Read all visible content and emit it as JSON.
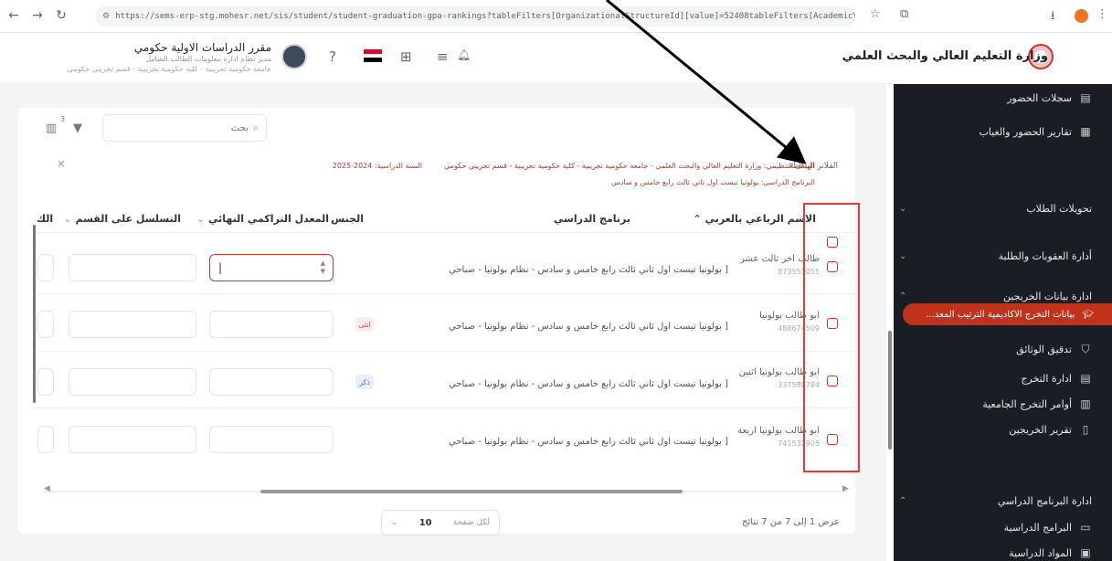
{
  "browser": {
    "url": "https://sems-erp-stg.mohesr.net/sis/student/student-graduation-gpa-rankings?tableFilters[OrganizationalStructureId][value]=52408tableFilters[AcademicYearAndProgram][StudyYearId]=1258tu..."
  },
  "header": {
    "ministry_name": "وزارة التعليم العالي والبحث العلمي",
    "user_name": "مقرر الدراسات الاولية حكومي",
    "user_role": "مدير نظام ادارة معلومات الطالب الشامل",
    "user_unit": "جامعة حكومية تجريبية - كلية حكومية تجريبية - قسم تجريبي حكومي"
  },
  "sidebar": {
    "item_attendance_records": "سجلات الحضور",
    "item_attendance_reports": "تقارير الحضور والغياب",
    "group_student_transfers": "تحويلات الطلاب",
    "group_penalties": "أدارة العقوبات والطلبة",
    "group_graduates_data": "ادارة بيانات الخريجين",
    "active_item": "بيانات التخرج الاكاديمية الترتيب المعد...",
    "item_document_check": "تدقيق الوثائق",
    "item_graduation_mgmt": "ادارة التخرج",
    "item_university_orders": "أوامر التخرج الجامعية",
    "item_graduates_report": "تقرير الخريجين",
    "group_program_mgmt": "ادارة البرنامج الدراسي",
    "item_programs": "البرامج الدراسية",
    "item_last": "المواد الدراسية"
  },
  "toolbar": {
    "search_placeholder": "بحث",
    "filter_count": "3"
  },
  "filters": {
    "label": "الفلاتر النشطة",
    "chip_org": "الهيكل التنظيمي: وزارة التعليم العالي والبحث العلمي - جامعة حكومية تجريبية - كلية حكومية تجريبية - قسم تجريبي حكومي",
    "chip_year": "السنة الدراسية: 2024-2025",
    "chip_program": "البرنامج الدراسي: بولونيا تيست اول ثاني ثالث رابع خامس و سادس"
  },
  "table": {
    "columns": {
      "name": "الاسم الرباعي بالعربي",
      "program": "برنامج الدراسي",
      "gender": "الجنس",
      "gpa": "المعدل التراكمي النهائي",
      "dept_rank": "التسلسل على القسم",
      "last": "الك"
    },
    "rows": [
      {
        "name": "طالب اخر ثالث عشر",
        "id": "873551055",
        "program": "[ بولونيا تيست اول ثاني ثالث رابع خامس و سادس - نظام بولونيا - صباحي",
        "gender": ""
      },
      {
        "name": "ابو طالب بولونيا",
        "id": "488674509",
        "program": "[ بولونيا تيست اول ثاني ثالث رابع خامس و سادس - نظام بولونيا - صباحي",
        "gender": "انثى"
      },
      {
        "name": "ابو طالب بولونيا اثنين",
        "id": "337580784",
        "program": "[ بولونيا تيست اول ثاني ثالث رابع خامس و سادس - نظام بولونيا - صباحي",
        "gender": "ذكر"
      },
      {
        "name": "ابو طالب بولونيا اربعة",
        "id": "741532905",
        "program": "[ بولونيا تيست اول ثاني ثالث رابع خامس و سادس - نظام بولونيا - صباحي",
        "gender": ""
      }
    ]
  },
  "pagination": {
    "per_page_label": "لكل صفحة",
    "per_page_value": "10",
    "showing": "عرض 1 إلى 7 من 7 نتائج"
  },
  "colors": {
    "accent": "#c0321c",
    "sidebar_bg": "#1a1d23",
    "annotation_red": "#e53935"
  }
}
